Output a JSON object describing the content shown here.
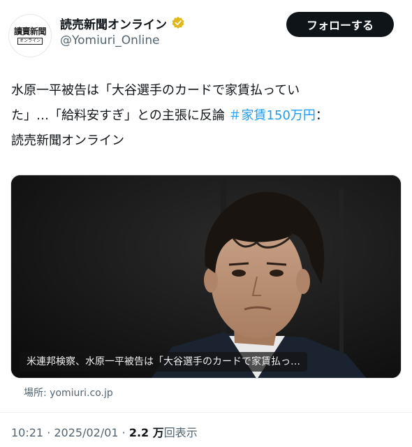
{
  "account": {
    "avatar_logo": "讀賣新聞",
    "avatar_sub": "オンライン",
    "display_name": "読売新聞オンライン",
    "verified_icon": "verified-badge-icon",
    "handle": "@Yomiuri_Online",
    "follow_label": "フォローする"
  },
  "post": {
    "line1": "水原一平被告は「大谷選手のカードで家賃払ってい",
    "line2_text": "た」…「給料安すぎ」との主張に反論 ",
    "hashtag": "＃家賃150万円",
    "line2_tail": "：",
    "line3": "読売新聞オンライン"
  },
  "media": {
    "caption": "米連邦検察、水原一平被告は「大谷選手のカードで家賃払っ…"
  },
  "link_card": {
    "source": "場所: yomiuri.co.jp"
  },
  "meta": {
    "time_date": "10:21 · 2025/02/01 · ",
    "views_count": "2.2 万",
    "views_label": "回表示"
  },
  "colors": {
    "text": "#0f1419",
    "secondary": "#536471",
    "link": "#1d9bf0",
    "verified_gold": "#e2b719",
    "follow_bg": "#0f1419"
  }
}
